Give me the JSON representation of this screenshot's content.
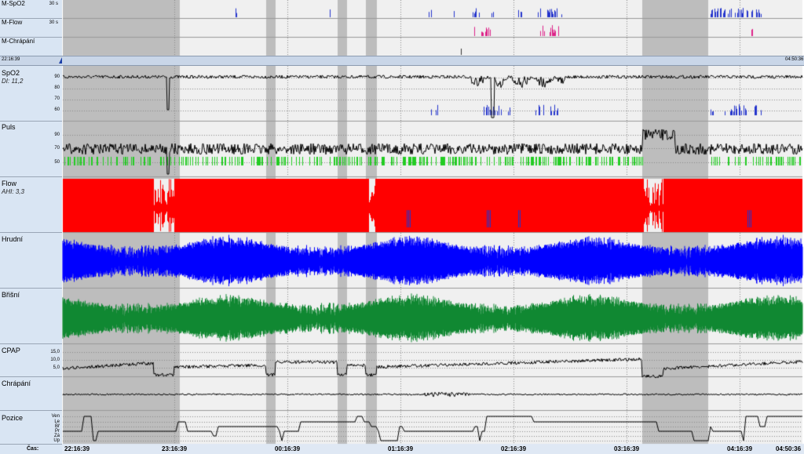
{
  "overview": {
    "channels": [
      {
        "name": "M-SpO2",
        "tick": "30 s"
      },
      {
        "name": "M-Flow",
        "tick": "30 s"
      },
      {
        "name": "M-Chrápání",
        "tick": ""
      }
    ],
    "nav_start": "22:16:39",
    "nav_end": "04:50:36"
  },
  "channels": [
    {
      "name": "SpO2",
      "sub": "DI: 11,2",
      "ticks": [
        "90",
        "80",
        "70",
        "60"
      ]
    },
    {
      "name": "Puls",
      "sub": "",
      "ticks": [
        "90",
        "70",
        "50"
      ]
    },
    {
      "name": "Flow",
      "sub": "AHI: 3,3",
      "ticks": []
    },
    {
      "name": "Hrudní",
      "sub": "",
      "ticks": []
    },
    {
      "name": "Břišní",
      "sub": "",
      "ticks": []
    },
    {
      "name": "CPAP",
      "sub": "",
      "ticks": [
        "15,0",
        "10,0",
        "5,0"
      ]
    },
    {
      "name": "Chrápání",
      "sub": "",
      "ticks": []
    },
    {
      "name": "Pozice",
      "sub": "",
      "ticks": [
        "Ven",
        "Le",
        "Bř",
        "Pr",
        "Zá",
        "Up"
      ]
    }
  ],
  "time_axis": {
    "label": "Čas:",
    "ticks": [
      "22:16:39",
      "23:16:39",
      "00:16:39",
      "01:16:39",
      "02:16:39",
      "03:16:39",
      "04:16:39",
      "04:50:36"
    ]
  },
  "colors": {
    "spo2": "#000000",
    "pulse": "#000000",
    "pulse_events": "#22cc22",
    "flow": "#ff0000",
    "chest": "#0000ff",
    "abdomen": "#118833",
    "events_blue": "#2233cc",
    "events_pink": "#dd2288",
    "gray_band": "#bdbdbd"
  }
}
